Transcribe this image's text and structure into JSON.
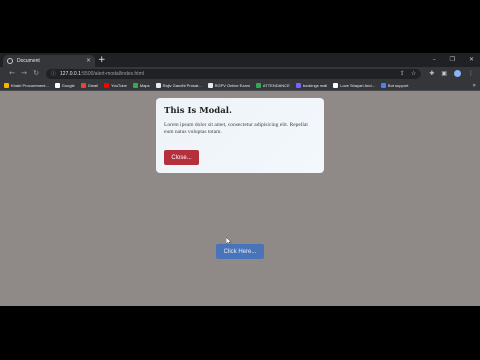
{
  "browser": {
    "tab_title": "Document",
    "tab_close": "×",
    "new_tab": "+",
    "window_controls": [
      "–",
      "❐",
      "✕"
    ],
    "url_host": "127.0.0.1",
    "url_path": ":5500/alert-modal/index.html",
    "bookmarks": [
      {
        "label": "Khatri Procurement...",
        "color": "#f4b400"
      },
      {
        "label": "Google",
        "color": "#ffffff"
      },
      {
        "label": "Gmail",
        "color": "#ea4335"
      },
      {
        "label": "YouTube",
        "color": "#ff0000"
      },
      {
        "label": "Maps",
        "color": "#34a853"
      },
      {
        "label": "Rajiv Gandhi Prosat...",
        "color": "#e8eaed"
      },
      {
        "label": "RGPV Online Exam",
        "color": "#e8eaed"
      },
      {
        "label": "ATTENDANCE",
        "color": "#34a853"
      },
      {
        "label": "bookings mail",
        "color": "#7b61ff"
      },
      {
        "label": "Love Shayari And...",
        "color": "#ffffff"
      },
      {
        "label": "Bot support",
        "color": "#4285f4"
      }
    ],
    "bookmarks_more": "»"
  },
  "modal": {
    "title": "This Is Modal.",
    "text": "Lorem ipsum dolor sit amet, consectetur adipisicing elit. Repellat eum natus voluptas totam.",
    "close_label": "Close..."
  },
  "page": {
    "open_label": "Click Here..."
  }
}
